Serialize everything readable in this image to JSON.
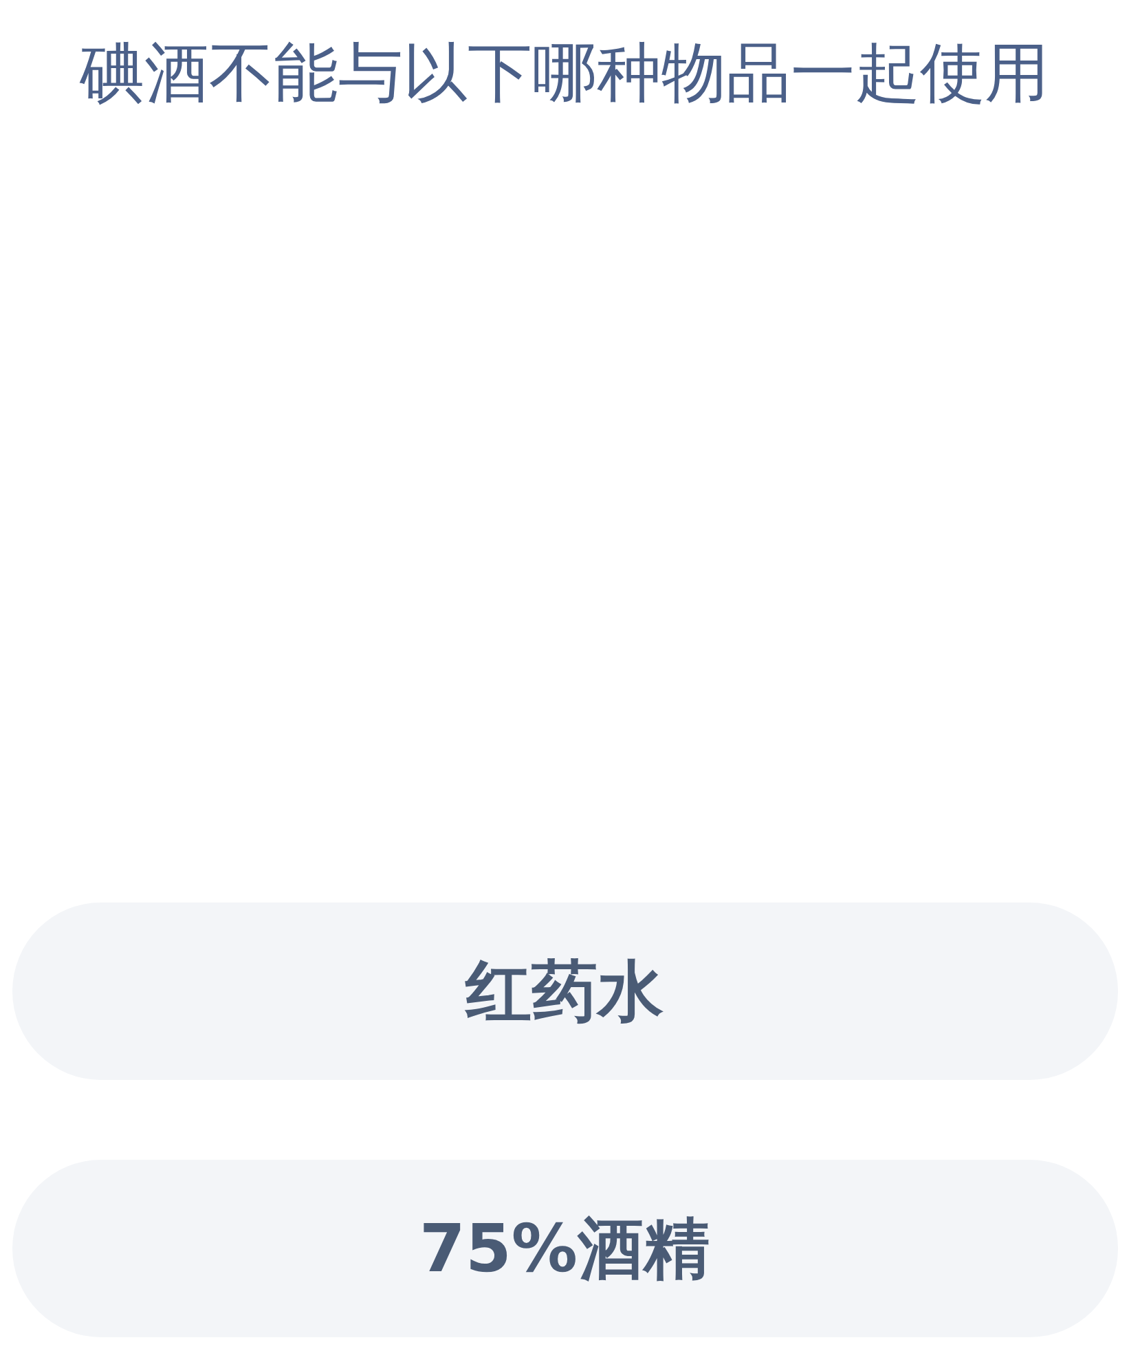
{
  "question": "碘酒不能与以下哪种物品一起使用",
  "options": [
    {
      "label": "红药水"
    },
    {
      "label": "75%酒精"
    }
  ]
}
